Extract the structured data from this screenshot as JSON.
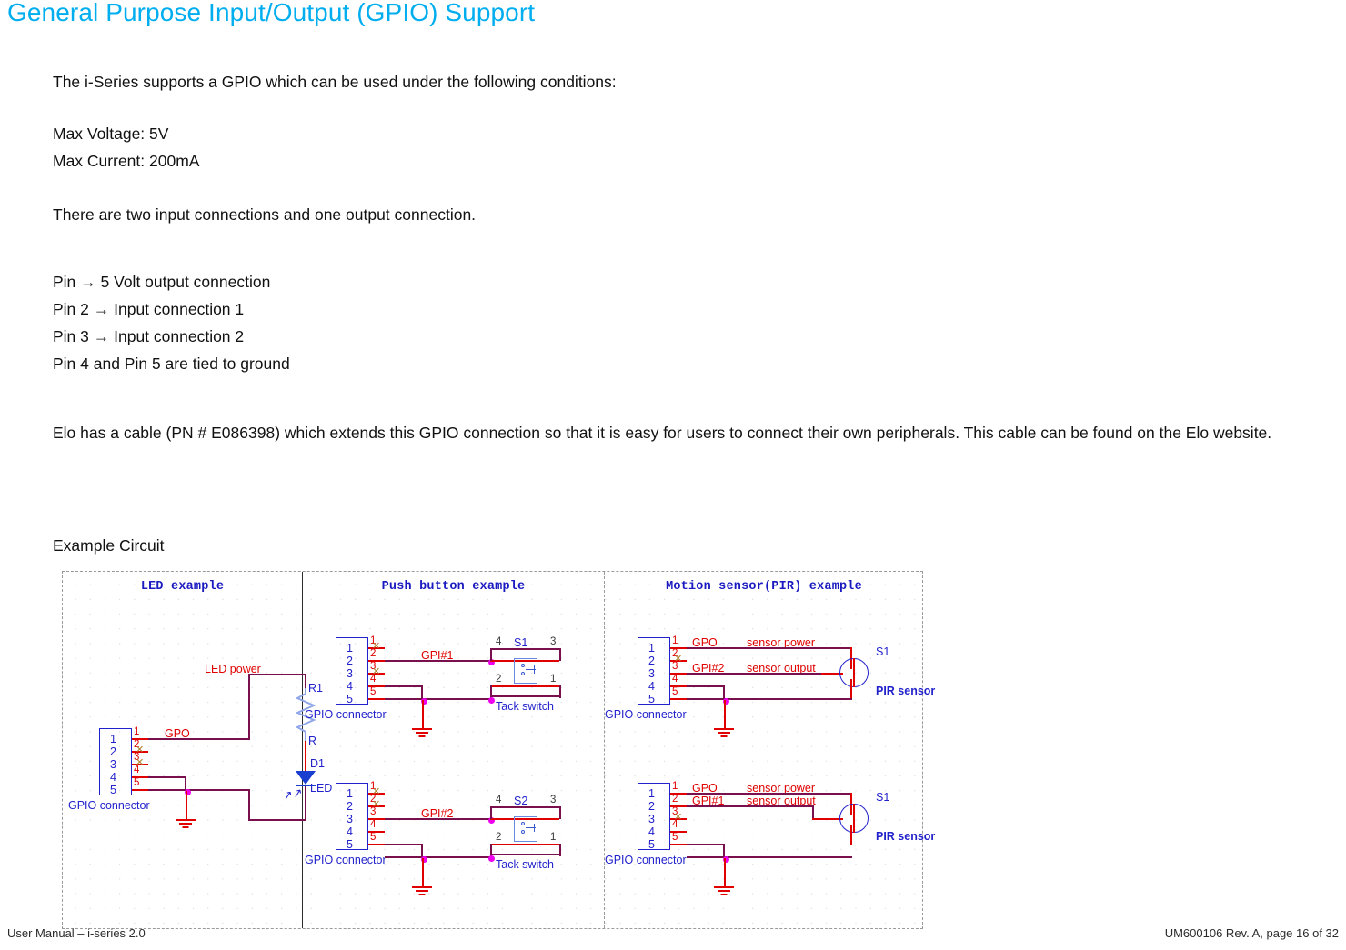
{
  "document": {
    "title": "General Purpose Input/Output (GPIO) Support",
    "intro": "The i-Series supports a GPIO which can be used under the following conditions:",
    "max_voltage": "Max Voltage: 5V",
    "max_current": "Max Current: 200mA",
    "connections_note": "There are two input connections and one output connection.",
    "pin_lines": [
      "Pin → 5 Volt output connection",
      "Pin 2 → Input connection 1",
      "Pin 3 → Input connection 2",
      "Pin 4 and Pin 5 are tied to ground"
    ],
    "cable_paragraph": "Elo has a cable (PN # E086398) which extends this GPIO connection so that it is easy for users to connect their own peripherals. This cable can be found on the Elo website.",
    "example_label": "Example Circuit"
  },
  "colors": {
    "title": "#00AEEF",
    "wire": "#7a0f4e",
    "net_label": "#e00000",
    "part_label": "#2222cc",
    "junction": "#ee00ee"
  },
  "diagram": {
    "panels": {
      "led": {
        "title": "LED example",
        "connector_label": "GPIO connector",
        "connector_nums": [
          "1",
          "2",
          "3",
          "4",
          "5"
        ],
        "pin_nums": [
          "1",
          "2",
          "3",
          "4",
          "5"
        ],
        "nets": {
          "gpo": "GPO",
          "led_power": "LED power"
        },
        "parts": {
          "r_ref": "R1",
          "r_val": "R",
          "d_ref": "D1",
          "d_val": "LED"
        }
      },
      "push": {
        "title": "Push button example",
        "circuits": [
          {
            "connector_label": "GPIO connector",
            "connector_nums": [
              "1",
              "2",
              "3",
              "4",
              "5"
            ],
            "pin_nums": [
              "1",
              "2",
              "3",
              "4",
              "5"
            ],
            "net": "GPI#1",
            "switch_ref": "S1",
            "switch_name": "Tack switch",
            "switch_pins": [
              "4",
              "3",
              "2",
              "1"
            ]
          },
          {
            "connector_label": "GPIO connector",
            "connector_nums": [
              "1",
              "2",
              "3",
              "4",
              "5"
            ],
            "pin_nums": [
              "1",
              "2",
              "3",
              "4",
              "5"
            ],
            "net": "GPI#2",
            "switch_ref": "S2",
            "switch_name": "Tack switch",
            "switch_pins": [
              "4",
              "3",
              "2",
              "1"
            ]
          }
        ]
      },
      "pir": {
        "title": "Motion sensor(PIR) example",
        "circuits": [
          {
            "connector_label": "GPIO connector",
            "connector_nums": [
              "1",
              "2",
              "3",
              "4",
              "5"
            ],
            "pin_nums": [
              "1",
              "2",
              "3",
              "4",
              "5"
            ],
            "net_power": "GPO",
            "net_power_desc": "sensor power",
            "net_out": "GPI#2",
            "net_out_desc": "sensor output",
            "sensor_ref": "S1",
            "sensor_name": "PIR sensor"
          },
          {
            "connector_label": "GPIO connector",
            "connector_nums": [
              "1",
              "2",
              "3",
              "4",
              "5"
            ],
            "pin_nums": [
              "1",
              "2",
              "3",
              "4",
              "5"
            ],
            "net_power": "GPO",
            "net_power_desc": "sensor power",
            "net_out": "GPI#1",
            "net_out_desc": "sensor output",
            "sensor_ref": "S1",
            "sensor_name": "PIR sensor"
          }
        ]
      }
    }
  },
  "footer": {
    "left": "User Manual – i-series 2.0",
    "right": "UM600106 Rev. A, page 16 of 32"
  }
}
